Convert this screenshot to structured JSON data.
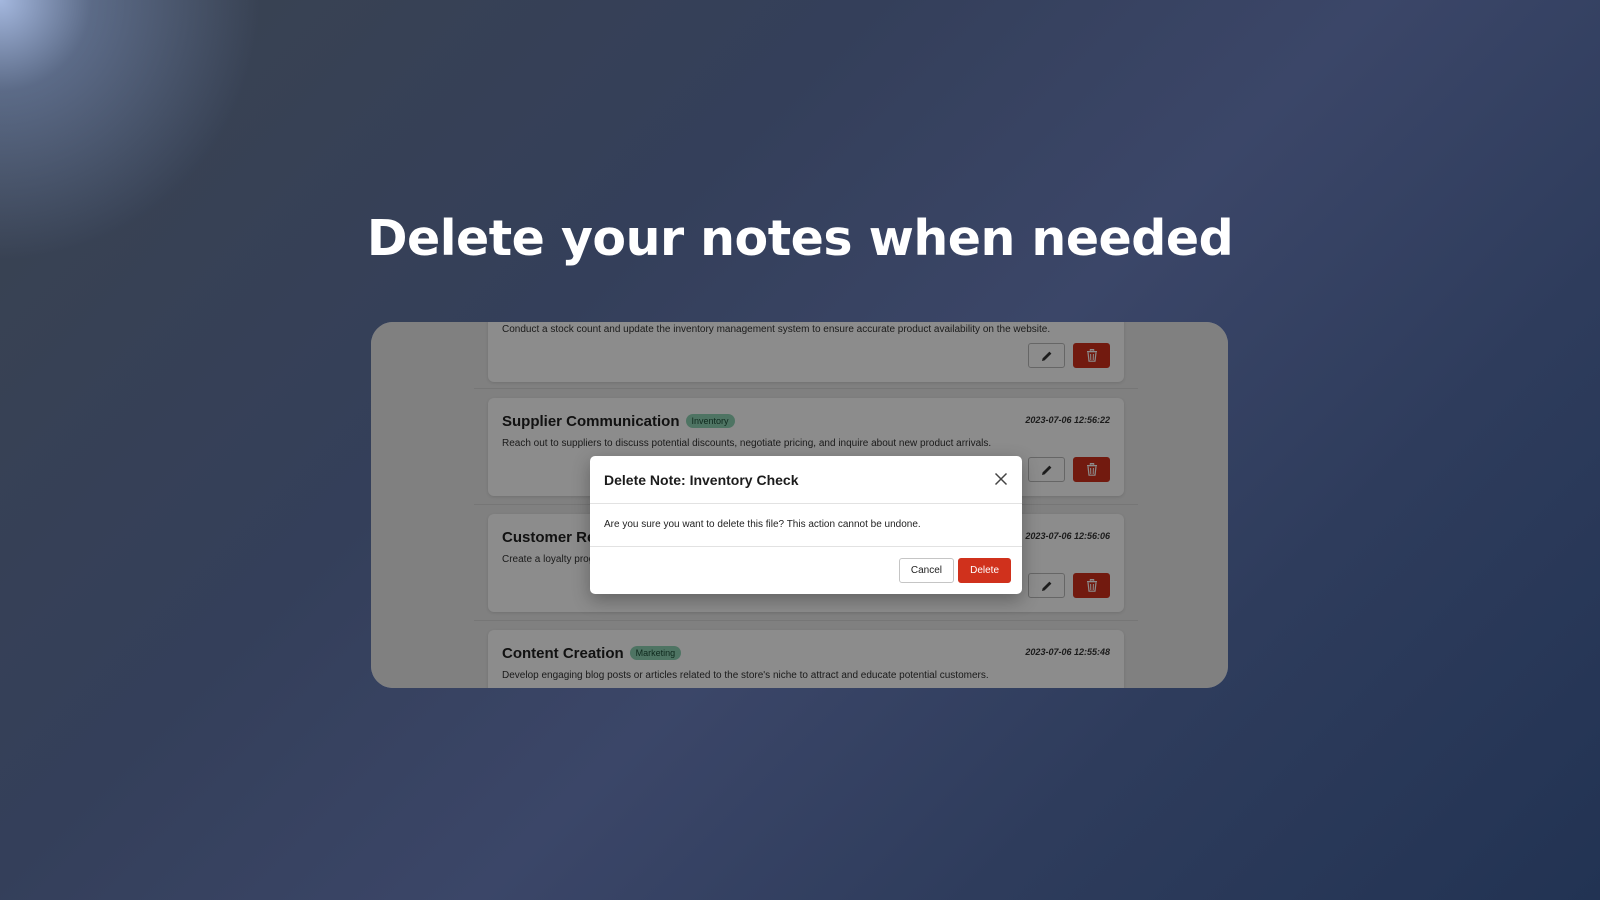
{
  "headline": "Delete your notes when needed",
  "notes": [
    {
      "title": "",
      "tag": "",
      "date": "",
      "body": "Conduct a stock count and update the inventory management system to ensure accurate product availability on the website."
    },
    {
      "title": "Supplier Communication",
      "tag": "Inventory",
      "date": "2023-07-06 12:56:22",
      "body": "Reach out to suppliers to discuss potential discounts, negotiate pricing, and inquire about new product arrivals."
    },
    {
      "title": "Customer Re",
      "tag": "",
      "date": "2023-07-06 12:56:06",
      "body": "Create a loyalty prog"
    },
    {
      "title": "Content Creation",
      "tag": "Marketing",
      "date": "2023-07-06 12:55:48",
      "body": "Develop engaging blog posts or articles related to the store's niche to attract and educate potential customers."
    }
  ],
  "modal": {
    "title": "Delete Note: Inventory Check",
    "message": "Are you sure you want to delete this file? This action cannot be undone.",
    "cancel_label": "Cancel",
    "delete_label": "Delete"
  },
  "icons": {
    "edit": "pencil-icon",
    "trash": "trash-icon",
    "close": "close-icon"
  },
  "colors": {
    "danger": "#d0311c",
    "tag_bg": "#8fd3b5",
    "tag_text": "#1d4d37"
  }
}
